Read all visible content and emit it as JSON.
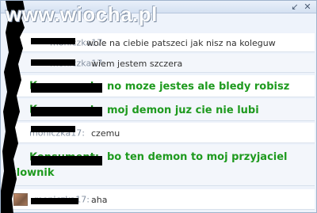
{
  "watermark": "www.wiocha.pl",
  "window": {
    "expand_icon": "expand-icon",
    "close_icon": "close-icon"
  },
  "messages": [
    {
      "nick": "moniczka17:",
      "text": "wole na ciebie patszeci jak nisz na koleguw",
      "style": "normal"
    },
    {
      "nick": "moniczka17:",
      "text": "wiem jestem szczera",
      "style": "normal"
    },
    {
      "nick": "Konsument:",
      "text": "no moze jestes ale bledy robisz",
      "style": "bold"
    },
    {
      "nick": "Konsument:",
      "text": "moj demon juz cie nie lubi",
      "style": "bold"
    },
    {
      "nick": "moniczka17:",
      "text": "czemu",
      "style": "normal"
    },
    {
      "nick": "Konsument:",
      "text": "bo ten demon to moj przyjaciel",
      "text2": "slownik",
      "style": "bold"
    },
    {
      "nick": "moniczka17:",
      "text": "aha",
      "style": "normal"
    }
  ]
}
